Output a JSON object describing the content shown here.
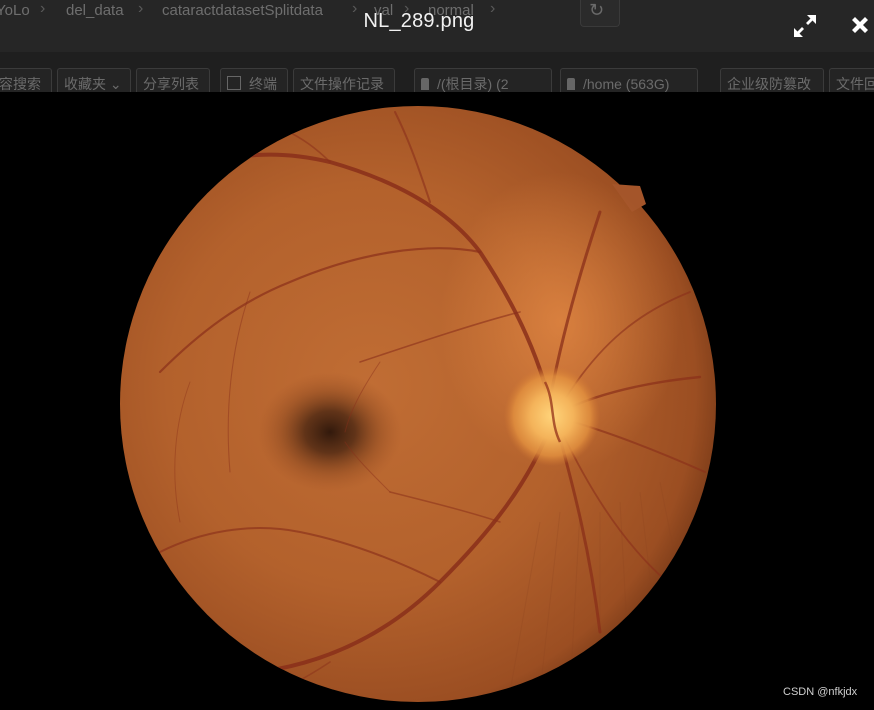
{
  "background_app": {
    "breadcrumbs": [
      "YoLo",
      "del_data",
      "cataractdatasetSplitdata",
      "val",
      "normal"
    ],
    "toolbar": [
      {
        "label": "容搜索",
        "icon": ""
      },
      {
        "label": "收藏夹",
        "icon": "chevron-down-icon"
      },
      {
        "label": "分享列表",
        "icon": ""
      },
      {
        "label": "终端",
        "icon": "terminal-icon"
      },
      {
        "label": "文件操作记录",
        "icon": ""
      },
      {
        "label": "/(根目录) (2",
        "icon": "drive-icon"
      },
      {
        "label": "/home (563G)",
        "icon": "drive-icon"
      },
      {
        "label": "企业级防篡改",
        "icon": ""
      },
      {
        "label": "文件回",
        "icon": ""
      }
    ]
  },
  "viewer": {
    "title": "NL_289.png",
    "expand_icon": "expand-icon",
    "close_icon": "close-icon"
  },
  "image": {
    "subject": "retinal fundus photograph",
    "colors": {
      "retina": "#b8642e",
      "optic_disc": "#f4b35a",
      "macula": "#3a1d0e",
      "vessels": "#8a2f1a"
    }
  },
  "watermark": "CSDN @nfkjdx"
}
